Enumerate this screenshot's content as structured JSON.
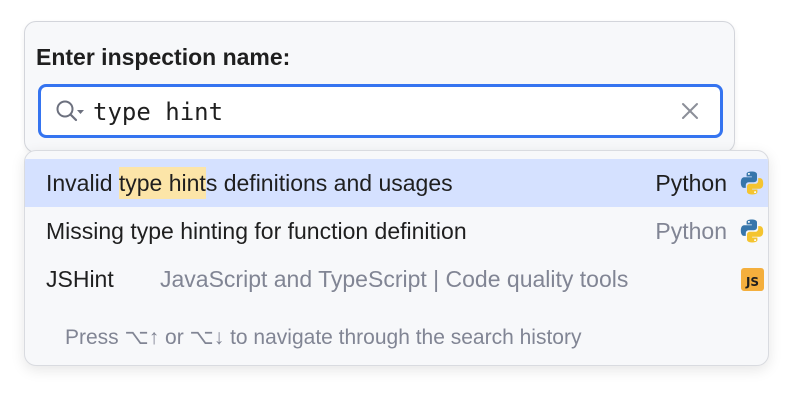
{
  "search": {
    "title": "Enter inspection name:",
    "value": "type hint",
    "icons": {
      "search": "search-with-dropdown-icon",
      "clear": "close-icon"
    },
    "accent_color": "#3574f0"
  },
  "results": {
    "items": [
      {
        "name_prefix": "Invalid ",
        "name_highlight": "type hint",
        "name_suffix": "s definitions and usages",
        "group": "",
        "language": "Python",
        "icon": "python-icon",
        "selected": true
      },
      {
        "name_prefix": "Missing type hinting for function definition",
        "name_highlight": "",
        "name_suffix": "",
        "group": "",
        "language": "Python",
        "icon": "python-icon",
        "selected": false
      },
      {
        "name_prefix": "JSHint",
        "name_highlight": "",
        "name_suffix": "",
        "group": "JavaScript and TypeScript | Code quality tools",
        "language": "",
        "icon": "javascript-icon",
        "icon_text": "JS",
        "selected": false
      }
    ],
    "hint": "Press ⌥↑ or ⌥↓ to navigate through the search history"
  },
  "colors": {
    "selection_bg": "#d5e1ff",
    "match_highlight_bg": "#fce5a8",
    "muted_text": "#818594",
    "js_badge": "#f4af3d"
  }
}
